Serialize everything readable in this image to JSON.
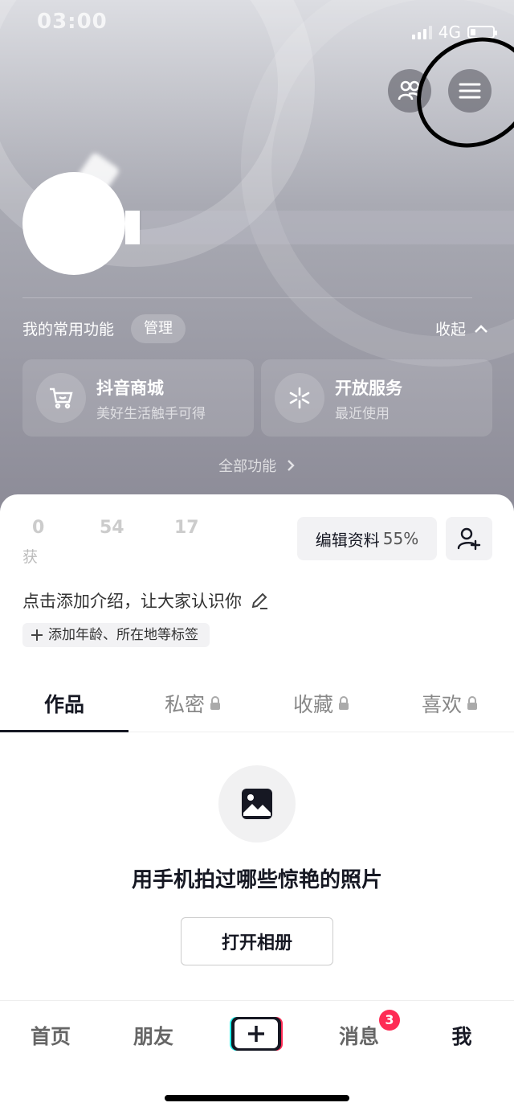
{
  "status_bar": {
    "time": "03:00",
    "network": "4G"
  },
  "header": {
    "friends_icon": "people-icon",
    "menu_icon": "hamburger-menu-icon"
  },
  "functions": {
    "title": "我的常用功能",
    "manage_label": "管理",
    "collapse_label": "收起",
    "cards": [
      {
        "icon": "cart-icon",
        "title": "抖音商城",
        "subtitle": "美好生活触手可得"
      },
      {
        "icon": "service-icon",
        "title": "开放服务",
        "subtitle": "最近使用"
      }
    ],
    "all_label": "全部功能"
  },
  "profile": {
    "stats": [
      "0",
      "54",
      "17"
    ],
    "stat_label_partial": "获",
    "edit_label": "编辑资料",
    "edit_progress": "55%",
    "intro": "点击添加介绍，让大家认识你",
    "tag_label": "添加年龄、所在地等标签"
  },
  "tabs": [
    {
      "label": "作品",
      "locked": false
    },
    {
      "label": "私密",
      "locked": true
    },
    {
      "label": "收藏",
      "locked": true
    },
    {
      "label": "喜欢",
      "locked": true
    }
  ],
  "empty_state": {
    "icon": "image-icon",
    "text": "用手机拍过哪些惊艳的照片",
    "button": "打开相册"
  },
  "bottom_nav": {
    "items": [
      "首页",
      "朋友",
      "消息",
      "我"
    ],
    "messages_badge": "3"
  },
  "colors": {
    "accent": "#fe2c55",
    "text_primary": "#161823"
  }
}
